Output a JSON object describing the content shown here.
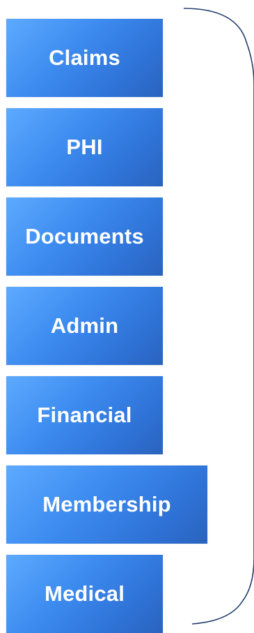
{
  "boxes": [
    {
      "label": "Claims"
    },
    {
      "label": "PHI"
    },
    {
      "label": "Documents"
    },
    {
      "label": "Admin"
    },
    {
      "label": "Financial"
    },
    {
      "label": "Membership"
    },
    {
      "label": "Medical"
    }
  ],
  "colors": {
    "box_gradient_start": "#5eaaff",
    "box_gradient_end": "#2a63bd",
    "box_text": "#ffffff",
    "bracket_stroke": "#1f3a6b"
  }
}
